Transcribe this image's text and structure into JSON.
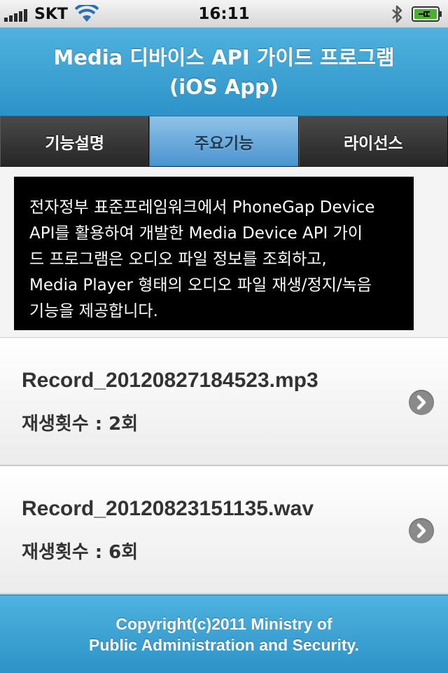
{
  "status_bar": {
    "carrier": "SKT",
    "time": "16:11",
    "icons": [
      "signal-bars-icon",
      "wifi-icon",
      "bluetooth-icon",
      "battery-charging-icon"
    ]
  },
  "header": {
    "title_line1": "Media 디바이스 API 가이드 프로그램",
    "title_line2": "(iOS App)"
  },
  "tabs": [
    {
      "label": "기능설명",
      "active": false
    },
    {
      "label": "주요기능",
      "active": true
    },
    {
      "label": "라이선스",
      "active": false
    }
  ],
  "description": {
    "lines": [
      "전자정부 표준프레임워크에서 PhoneGap Device",
      "API를 활용하여 개발한 Media Device API 가이",
      "드 프로그램은 오디오 파일 정보를 조회하고,",
      "Media Player 형태의 오디오 파일 재생/정지/녹음",
      "기능을 제공합니다."
    ]
  },
  "files": [
    {
      "name": "Record_20120827184523.mp3",
      "play_count": "재생횟수 : 2회"
    },
    {
      "name": "Record_20120823151135.wav",
      "play_count": "재생횟수 : 6회"
    }
  ],
  "footer": {
    "line1": "Copyright(c)2011 Ministry of",
    "line2": "Public Administration and Security."
  },
  "colors": {
    "header_blue": "#3aa0d4",
    "active_tab": "#6aaee0",
    "tab_dark": "#333333",
    "arrow_gray": "#8a8a8a"
  }
}
